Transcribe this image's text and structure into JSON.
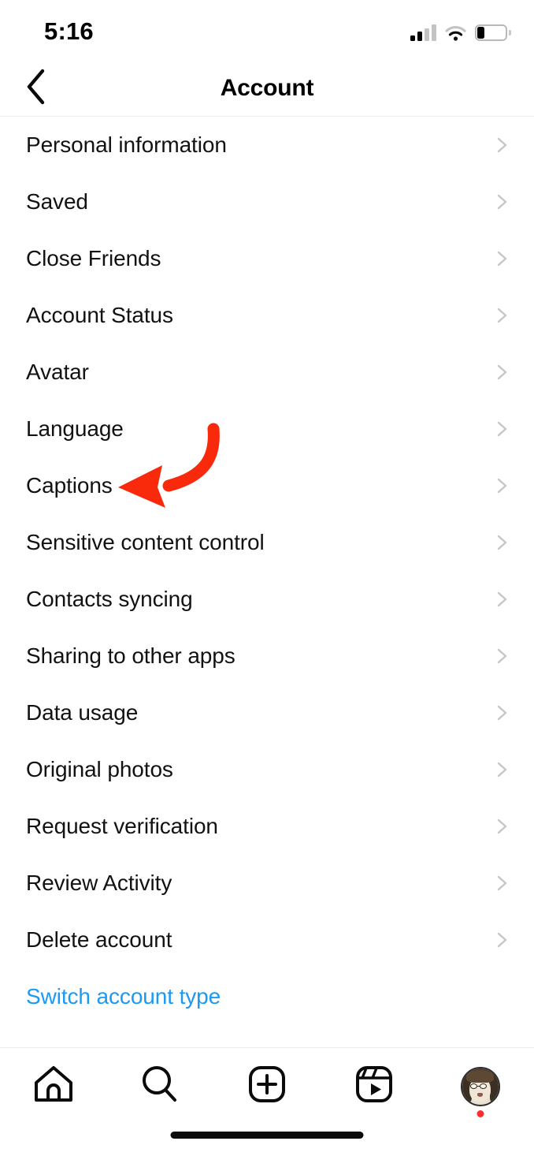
{
  "status_bar": {
    "time": "5:16",
    "signal_icon": "cellular-signal-icon",
    "signal_bars_filled": 2,
    "signal_bars_total": 4,
    "wifi_icon": "wifi-icon",
    "battery_icon": "battery-low-icon",
    "battery_level_percent": 25
  },
  "header": {
    "back_icon": "chevron-left-icon",
    "title": "Account"
  },
  "list": {
    "chevron_icon": "chevron-right-icon",
    "items": [
      {
        "label": "Personal information",
        "type": "nav",
        "has_chevron": true
      },
      {
        "label": "Saved",
        "type": "nav",
        "has_chevron": true
      },
      {
        "label": "Close Friends",
        "type": "nav",
        "has_chevron": true
      },
      {
        "label": "Account Status",
        "type": "nav",
        "has_chevron": true
      },
      {
        "label": "Avatar",
        "type": "nav",
        "has_chevron": true
      },
      {
        "label": "Language",
        "type": "nav",
        "has_chevron": true
      },
      {
        "label": "Captions",
        "type": "nav",
        "has_chevron": true
      },
      {
        "label": "Sensitive content control",
        "type": "nav",
        "has_chevron": true
      },
      {
        "label": "Contacts syncing",
        "type": "nav",
        "has_chevron": true
      },
      {
        "label": "Sharing to other apps",
        "type": "nav",
        "has_chevron": true
      },
      {
        "label": "Data usage",
        "type": "nav",
        "has_chevron": true
      },
      {
        "label": "Original photos",
        "type": "nav",
        "has_chevron": true
      },
      {
        "label": "Request verification",
        "type": "nav",
        "has_chevron": true
      },
      {
        "label": "Review Activity",
        "type": "nav",
        "has_chevron": true
      },
      {
        "label": "Delete account",
        "type": "nav",
        "has_chevron": true
      },
      {
        "label": "Switch account type",
        "type": "link",
        "has_chevron": false
      }
    ]
  },
  "annotation": {
    "arrow_icon": "curved-arrow-left-icon",
    "color": "#f92a0c",
    "points_at": "Captions"
  },
  "tab_bar": {
    "tabs": [
      {
        "name": "home",
        "icon": "home-icon"
      },
      {
        "name": "search",
        "icon": "search-icon"
      },
      {
        "name": "create",
        "icon": "plus-square-icon"
      },
      {
        "name": "reels",
        "icon": "reels-icon"
      },
      {
        "name": "profile",
        "icon": "profile-avatar-icon",
        "badge": true
      }
    ],
    "badge_color": "#ff2d2d"
  },
  "colors": {
    "accent_blue": "#1a9af5",
    "text": "#121212",
    "chevron_gray": "#c7c7c7",
    "separator": "#ededed",
    "annotation_red": "#f92a0c"
  }
}
